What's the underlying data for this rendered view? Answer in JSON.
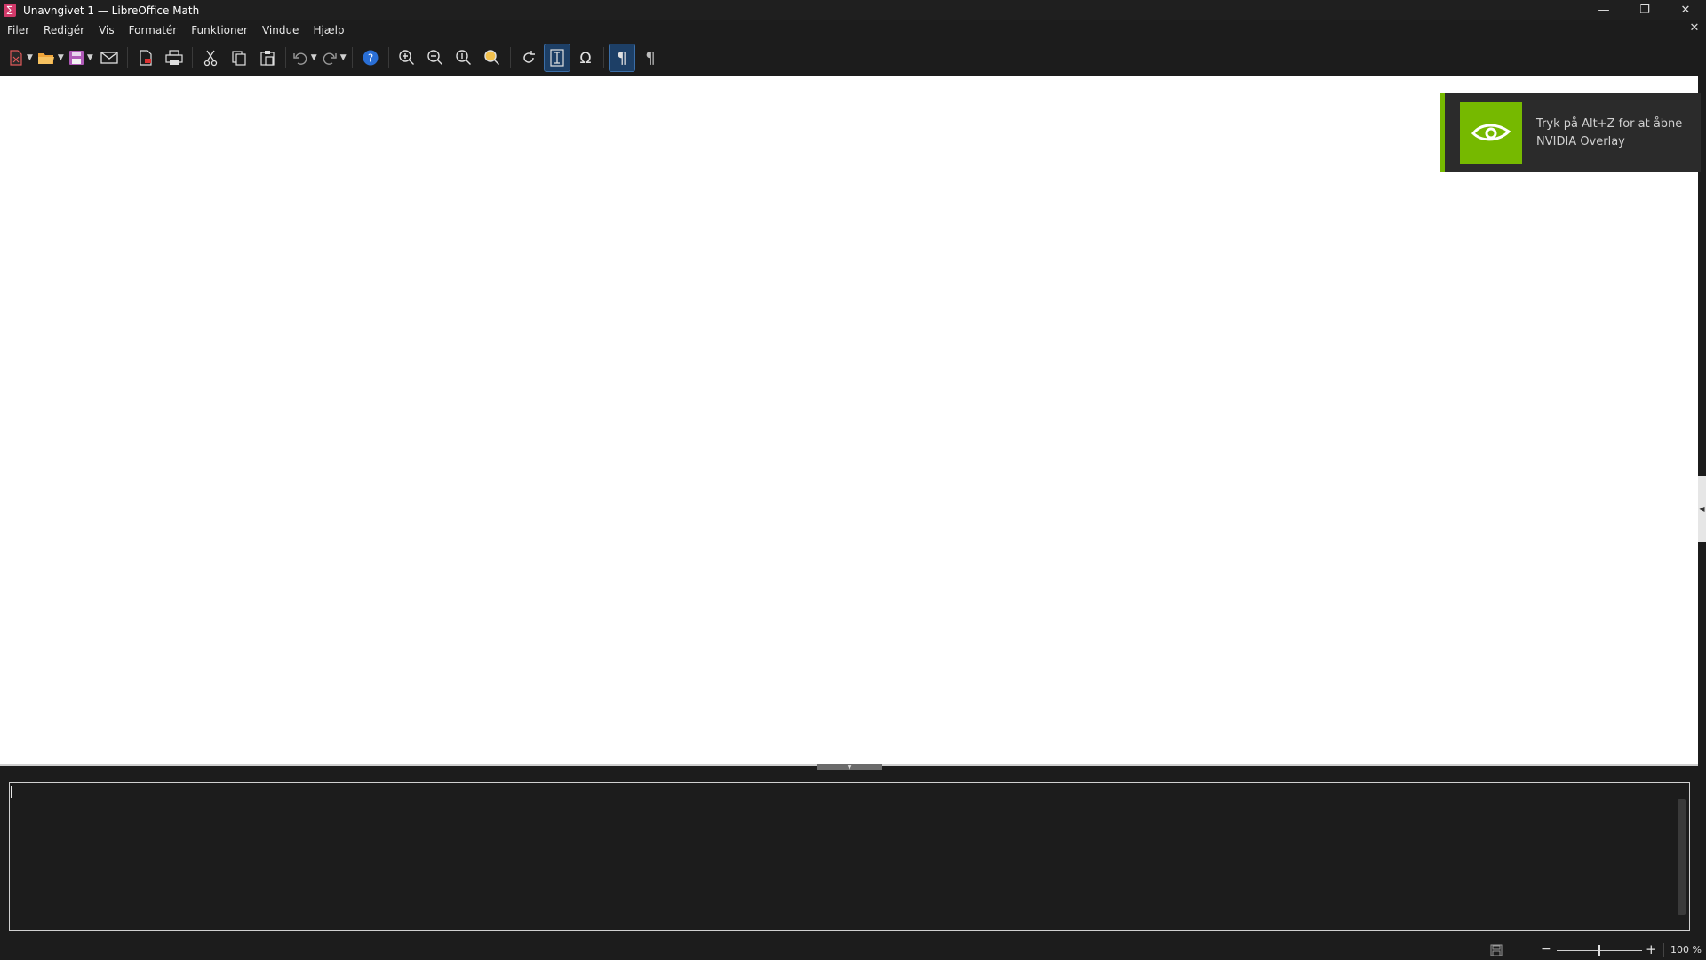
{
  "window": {
    "title": "Unavngivet 1 — LibreOffice Math",
    "logo_glyph": "∑",
    "minimize_glyph": "—",
    "restore_glyph": "❐",
    "close_glyph": "✕",
    "doc_close_glyph": "✕"
  },
  "menu": {
    "items": [
      "Filer",
      "Redigér",
      "Vis",
      "Formatér",
      "Funktioner",
      "Vindue",
      "Hjælp"
    ]
  },
  "toolbar": {
    "icons": [
      "new-document-icon",
      "open-folder-icon",
      "save-icon",
      "email-icon",
      "export-pdf-icon",
      "print-icon",
      "cut-icon",
      "copy-icon",
      "paste-icon",
      "undo-icon",
      "redo-icon",
      "help-icon",
      "zoom-in-icon",
      "zoom-out-icon",
      "zoom-100-icon",
      "show-all-icon",
      "update-icon",
      "formula-cursor-icon",
      "symbols-icon",
      "paragraph-ltr-icon",
      "paragraph-rtl-icon"
    ],
    "accent": "#1d3f66"
  },
  "nvidia_toast": {
    "text": "Tryk på Alt+Z for at åbne NVIDIA Overlay",
    "accent": "#76b900"
  },
  "command_area": {
    "value": ""
  },
  "statusbar": {
    "zoom_minus": "−",
    "zoom_plus": "+",
    "zoom_value": "100 %",
    "zoom_level_percent": 100
  }
}
